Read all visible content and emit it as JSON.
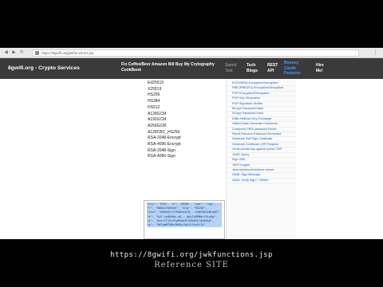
{
  "browser": {
    "url": "https://8gwifi.org/jwkfunctions.jsp",
    "back_icon": "arrow-left-icon",
    "forward_icon": "arrow-right-icon",
    "reload_icon": "reload-icon"
  },
  "nav": {
    "brand": "8gwifi.org - Crypto Services",
    "coffee": "Fix Coffee/Beer Amazon Bill Buy My Crytography CookBook",
    "speed": "Speed Test",
    "tech": "Tech Blogs",
    "rest": "REST API",
    "bouncy": "Bouncy Castle Features",
    "hire": "Hire Me!"
  },
  "algorithms": [
    "Ed25519",
    "X25519",
    "HS256",
    "HS384",
    "HS512",
    "A128GCM",
    "A192GCM",
    "A256GCM",
    "A128CBC_HS256",
    "RSA-2048-Encrypt",
    "RSA-4096-Encrypt",
    "RSA-2048-Sign",
    "RSA-4096-Sign"
  ],
  "output_text": "\"kty\": \"RSA\", \"e\": \"AQAB\", \"use\": \"sig\",\n\"n\": \"KWAAc7ed9ae\", \"alg\": \"RS256\",\n\"kid\": \"WADhUsrtC9bQn0o7W...9sWC0bGzWrgWJ\", \"d\": \"Sw7-cp0O9Wv-d5...q0yJxNPMdzYVLnRg\",\n\"p\": \"0x4r1T3Su9CpP5pAPrAXkNhI7QOQHxQ\", \"q\": \"YW7gbMT9MnZNV8vlWzlE7dsSfIk\"",
  "side_links": [
    "ECDH/RSA Encryption/Decryption",
    "PBE (PBKDF2) Encryption/Decryption",
    "PGP Encryption/Decryption",
    "PGP Key Generation",
    "PGP Signature Verifier",
    "BCrypt Password Hash",
    "SCrypt Password Hash",
    "Diffie-Hellman Key Exchange",
    "HMAC/Hash Generate Checksum",
    "Compress PEM password Finder",
    "Pkcs5 Random Password Generator",
    "Generate Self Sign Certificate",
    "Generate Certificate CSR Request",
    "Verify private key against (pem) CSR",
    "JOSE Query",
    "Sign JWE",
    "JWS Keygen",
    "Java keystore/truststore viewer",
    "SAML Sign Message",
    "SAML Verify Sign + Others"
  ],
  "caption": {
    "url": "https://8gwifi.org/jwkfunctions.jsp",
    "sub": "Reference SITE"
  },
  "colors": {
    "nav_bg": "#3a3a3a",
    "selection": "#b6d3f5",
    "link": "#1a5fb4",
    "active_nav": "#3aa0ff"
  }
}
